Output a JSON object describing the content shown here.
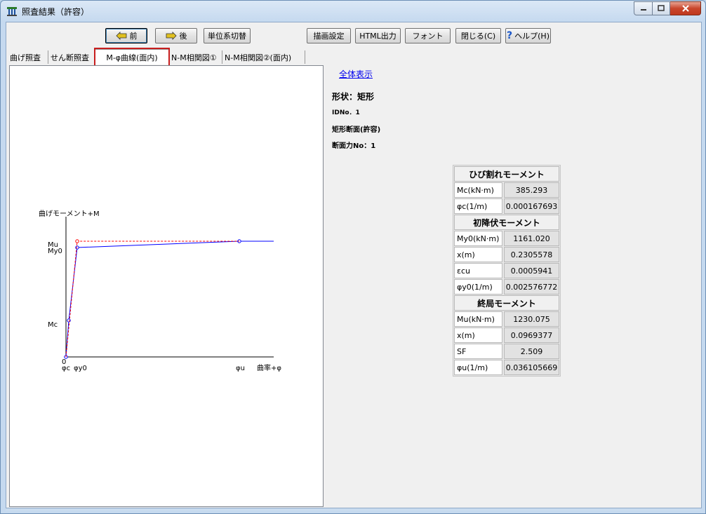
{
  "window": {
    "title": "照査結果（許容）"
  },
  "toolbar": {
    "prev": "前",
    "next": "後",
    "unit_switch": "単位系切替",
    "draw_settings": "描画設定",
    "html_output": "HTML出力",
    "font": "フォント",
    "close": "閉じる(C)",
    "help": "ヘルプ(H)"
  },
  "tabs": [
    "曲げ照査",
    "せん断照査",
    "M-φ曲線(面内)",
    "N-M相関図①",
    "N-M相関図②(面内)"
  ],
  "chart": {
    "y_axis_title": "曲げモーメント+M",
    "x_axis_title": "曲率+φ",
    "y_tick_mu": "Mu",
    "y_tick_my0": "My0",
    "y_tick_mc": "Mc",
    "origin": "0",
    "x_tick_phic": "φc",
    "x_tick_phiy0": "φy0",
    "x_tick_phiu": "φu",
    "colors": {
      "actual": "#0000ff",
      "model": "#ff0000"
    }
  },
  "chart_data": {
    "type": "line",
    "title": "",
    "xlabel": "曲率+φ",
    "ylabel": "曲げモーメント+M",
    "series": [
      {
        "name": "",
        "x": [
          0,
          0.000167693,
          0.002576772,
          0.036105669,
          0.042
        ],
        "y": [
          0,
          385.293,
          1161.02,
          1230.075,
          1230.075
        ]
      },
      {
        "name": "",
        "x": [
          0,
          0.002576772,
          0.036105669
        ],
        "y": [
          0,
          1230.075,
          1230.075
        ]
      }
    ]
  },
  "right": {
    "link": "全体表示",
    "shape": "形状：矩形",
    "id_no": "IDNo．1",
    "section": "矩形断面(許容)",
    "force_no": "断面力No：1"
  },
  "results": {
    "crack": {
      "title": "ひび割れモーメント",
      "rows": [
        {
          "label": "Mc(kN·m)",
          "value": "385.293"
        },
        {
          "label": "φc(1/m)",
          "value": "0.000167693"
        }
      ]
    },
    "yield": {
      "title": "初降伏モーメント",
      "rows": [
        {
          "label": "My0(kN·m)",
          "value": "1161.020"
        },
        {
          "label": "x(m)",
          "value": "0.2305578"
        },
        {
          "label": "εcu",
          "value": "0.0005941"
        },
        {
          "label": "φy0(1/m)",
          "value": "0.002576772"
        }
      ]
    },
    "ultimate": {
      "title": "終局モーメント",
      "rows": [
        {
          "label": "Mu(kN·m)",
          "value": "1230.075"
        },
        {
          "label": "x(m)",
          "value": "0.0969377"
        },
        {
          "label": "SF",
          "value": "2.509"
        },
        {
          "label": "φu(1/m)",
          "value": "0.036105669"
        }
      ]
    }
  }
}
